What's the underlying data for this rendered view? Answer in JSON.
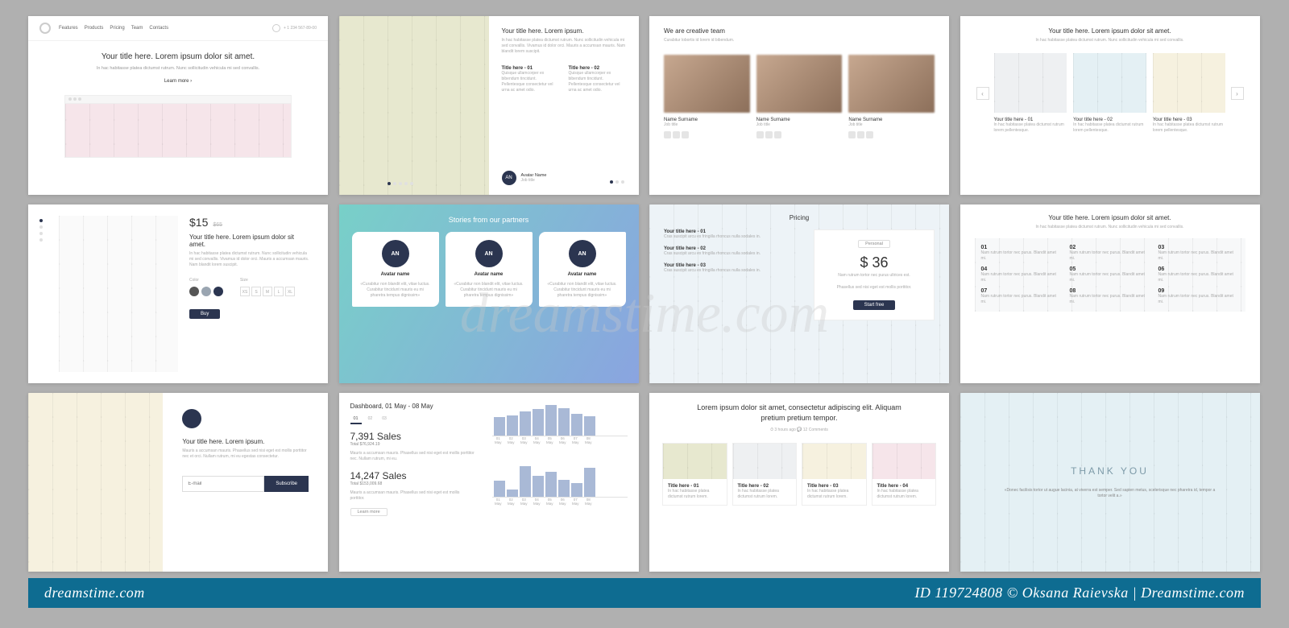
{
  "watermark": "dreamstime.com",
  "footer": {
    "left": "dreamstime.com",
    "right": "ID 119724808 © Oksana Raievska | Dreamstime.com"
  },
  "s1": {
    "nav": [
      "Features",
      "Products",
      "Pricing",
      "Team",
      "Contacts"
    ],
    "phone": "+ 1 234 567-89-00",
    "title": "Your title here. Lorem ipsum dolor sit amet.",
    "lead": "In hac habitasse platea dictumst rutrum. Nunc sollicitudin vehicula mi sed convallis.",
    "button": "Learn more"
  },
  "s2": {
    "title": "Your title here. Lorem ipsum.",
    "lead": "In hac habitasse platea dictumst rutrum. Nunc sollicitudin vehicula mi sed convallis. Vivamus id dolor orci. Mauris a accumsan mauris. Nam blandit lorem suscipit.",
    "col1_title": "Title here - 01",
    "col1_body": "Quisque ullamcorper ex bibendum tincidunt. Pellentesque consectetur vel urna ac amet odio.",
    "col2_title": "Title here - 02",
    "col2_body": "Quisque ullamcorper ex bibendum tincidunt. Pellentesque consectetur vel urna ac amet odio.",
    "avatar_initials": "AN",
    "avatar_name": "Avatar Name",
    "avatar_job": "Job title"
  },
  "s3": {
    "title": "We are creative team",
    "lead": "Curabitur lobortis id lorem id bibendum.",
    "members": [
      {
        "name": "Name Surname",
        "job": "Job title"
      },
      {
        "name": "Name Surname",
        "job": "Job title"
      },
      {
        "name": "Name Surname",
        "job": "Job title"
      }
    ]
  },
  "s4": {
    "title": "Your title here. Lorem ipsum dolor sit amet.",
    "lead": "In hac habitasse platea dictumst rutrum. Nunc sollicitudin vehicula mi sed convallis.",
    "items": [
      {
        "title": "Your title here - 01",
        "body": "In hac habitasse platea dictumst rutrum lorem pellentesque."
      },
      {
        "title": "Your title here - 02",
        "body": "In hac habitasse platea dictumst rutrum lorem pellentesque."
      },
      {
        "title": "Your title here - 03",
        "body": "In hac habitasse platea dictumst rutrum lorem pellentesque."
      }
    ]
  },
  "s5": {
    "price": "$15",
    "price_old": "$65",
    "title": "Your title here. Lorem ipsum dolor sit amet.",
    "body": "In hac habitasse platea dictumst rutrum. Nunc sollicitudin vehicula mi sed convallis. Vivamus id dolor orci. Mauris a accumsan mauris. Nam blandit lorem suscipit.",
    "label_color": "Color",
    "label_size": "Size",
    "sizes": [
      "XS",
      "S",
      "M",
      "L",
      "XL"
    ],
    "button": "Buy",
    "swatches": [
      "#555555",
      "#9aa5b1",
      "#2b3550"
    ]
  },
  "s6": {
    "title": "Stories from our partners",
    "cards": [
      {
        "initials": "AN",
        "name": "Avatar name",
        "quote": "«Curabitur non blandit elit, vitae luctus. Curabitur tincidunt mauris eu mi pharetra tempus dignissim»"
      },
      {
        "initials": "AN",
        "name": "Avatar name",
        "quote": "«Curabitur non blandit elit, vitae luctus. Curabitur tincidunt mauris eu mi pharetra tempus dignissim»"
      },
      {
        "initials": "AN",
        "name": "Avatar name",
        "quote": "«Curabitur non blandit elit, vitae luctus. Curabitur tincidunt mauris eu mi pharetra tempus dignissim»"
      }
    ]
  },
  "s7": {
    "title": "Pricing",
    "left": [
      {
        "title": "Your title here - 01",
        "body": "Cras suscipit arcu ex fringilla rhoncus nulla sodales in."
      },
      {
        "title": "Your title here - 02",
        "body": "Cras suscipit arcu ex fringilla rhoncus nulla sodales in."
      },
      {
        "title": "Your title here - 03",
        "body": "Cras suscipit arcu ex fringilla rhoncus nulla sodales in."
      }
    ],
    "plan_label": "Personal",
    "price": "$ 36",
    "price_note": "Nam rutrum tortor nec purus ultrices est.",
    "note": "Phasellus sed nisi eget est mollis porttitor.",
    "button": "Start free"
  },
  "s8": {
    "title": "Your title here. Lorem ipsum dolor sit amet.",
    "lead": "In hac habitasse platea dictumst rutrum. Nunc sollicitudin vehicula mi sed convallis.",
    "items": [
      {
        "n": "01",
        "t": "Nam rutrum tortor nec purus. Blandit amet mi."
      },
      {
        "n": "02",
        "t": "Nam rutrum tortor nec purus. Blandit amet mi."
      },
      {
        "n": "03",
        "t": "Nam rutrum tortor nec purus. Blandit amet mi."
      },
      {
        "n": "04",
        "t": "Nam rutrum tortor nec purus. Blandit amet mi."
      },
      {
        "n": "05",
        "t": "Nam rutrum tortor nec purus. Blandit amet mi."
      },
      {
        "n": "06",
        "t": "Nam rutrum tortor nec purus. Blandit amet mi."
      },
      {
        "n": "07",
        "t": "Nam rutrum tortor nec purus. Blandit amet mi."
      },
      {
        "n": "08",
        "t": "Nam rutrum tortor nec purus. Blandit amet mi."
      },
      {
        "n": "09",
        "t": "Nam rutrum tortor nec purus. Blandit amet mi."
      }
    ]
  },
  "s9": {
    "title": "Your title here. Lorem ipsum.",
    "body": "Mauris a accumsan mauris. Phasellus sed nisi eget est mollis porttitor nec et orci. Nullam rutrum, mi eu egestas consectetur.",
    "placeholder": "E-mail",
    "button": "Subscribe"
  },
  "s10": {
    "title": "Dashboard, 01 May - 08 May",
    "tabs": [
      "01",
      "02",
      "03"
    ],
    "metric1_value": "7,391 Sales",
    "metric1_sub": "Total $76,924.19",
    "metric1_body": "Mauris a accumsan mauris. Phasellus sed nisi eget est mollis porttitor nec. Nullam rutrum, mi eu.",
    "metric2_value": "14,247 Sales",
    "metric2_sub": "Total $153,009.68",
    "metric2_body": "Mauris a accumsan mauris. Phasellus sed nisi eget est mollis porttitor.",
    "button": "Learn more",
    "chart_data": [
      {
        "type": "bar",
        "categories": [
          "01 May",
          "02 May",
          "03 May",
          "04 May",
          "05 May",
          "06 May",
          "07 May",
          "08 May"
        ],
        "values": [
          55,
          60,
          72,
          78,
          90,
          80,
          65,
          58
        ]
      },
      {
        "type": "bar",
        "categories": [
          "01 May",
          "02 May",
          "03 May",
          "04 May",
          "05 May",
          "06 May",
          "07 May",
          "08 May"
        ],
        "values": [
          48,
          22,
          90,
          62,
          75,
          50,
          40,
          85
        ]
      }
    ]
  },
  "s11": {
    "title": "Lorem ipsum dolor sit amet, consectetur adipiscing elit. Aliquam pretium pretium tempor.",
    "meta": "⏱ 3 hours ago   💬 12 Comments",
    "cards": [
      {
        "title": "Title here - 01",
        "body": "In hac habitasse platea dictumst rutrum lorem."
      },
      {
        "title": "Title here - 02",
        "body": "In hac habitasse platea dictumst rutrum lorem."
      },
      {
        "title": "Title here - 03",
        "body": "In hac habitasse platea dictumst rutrum lorem."
      },
      {
        "title": "Title here - 04",
        "body": "In hac habitasse platea dictumst rutrum lorem."
      }
    ]
  },
  "s12": {
    "title": "THANK YOU",
    "quote": "«Donec facilisis tortor ut augue lacinia, at viverra est semper. Sed sapien metus, scelerisque nec pharetra id, tempor a tortor velit a.»"
  }
}
